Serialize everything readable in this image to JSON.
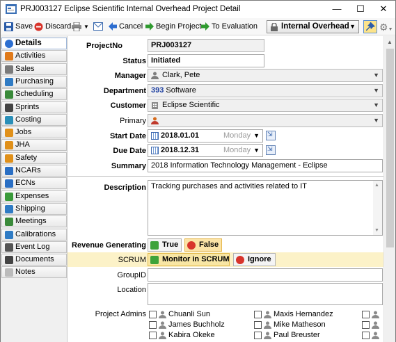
{
  "window": {
    "title": "PRJ003127 Eclipse Scientific Internal Overhead Project Detail",
    "minimize": "—",
    "maximize": "☐",
    "close": "✕"
  },
  "toolbar": {
    "save": "Save",
    "discard": "Discard",
    "cancel": "Cancel",
    "begin_project": "Begin Project",
    "to_evaluation": "To Evaluation",
    "mode": "Internal Overhead"
  },
  "sidebar": {
    "items": [
      {
        "label": "Details",
        "icon": "info-icon",
        "color": "#2d6fd1"
      },
      {
        "label": "Activities",
        "icon": "activities-icon",
        "color": "#e07a1a"
      },
      {
        "label": "Sales",
        "icon": "sales-icon",
        "color": "#7a7a7a"
      },
      {
        "label": "Purchasing",
        "icon": "purchasing-icon",
        "color": "#2f7bc4"
      },
      {
        "label": "Scheduling",
        "icon": "scheduling-icon",
        "color": "#3a8a3a"
      },
      {
        "label": "Sprints",
        "icon": "sprints-icon",
        "color": "#444444"
      },
      {
        "label": "Costing",
        "icon": "costing-icon",
        "color": "#2a8fb8"
      },
      {
        "label": "Jobs",
        "icon": "jobs-icon",
        "color": "#e0901a"
      },
      {
        "label": "JHA",
        "icon": "jha-icon",
        "color": "#e0901a"
      },
      {
        "label": "Safety",
        "icon": "safety-icon",
        "color": "#e0901a"
      },
      {
        "label": "NCARs",
        "icon": "ncars-icon",
        "color": "#2a6fc4"
      },
      {
        "label": "ECNs",
        "icon": "ecns-icon",
        "color": "#2a6fc4"
      },
      {
        "label": "Expenses",
        "icon": "expenses-icon",
        "color": "#3a9a3a"
      },
      {
        "label": "Shipping",
        "icon": "shipping-icon",
        "color": "#2f7bc4"
      },
      {
        "label": "Meetings",
        "icon": "meetings-icon",
        "color": "#3a8a3a"
      },
      {
        "label": "Calibrations",
        "icon": "calibrations-icon",
        "color": "#2f7bc4"
      },
      {
        "label": "Event Log",
        "icon": "event-log-icon",
        "color": "#555555"
      },
      {
        "label": "Documents",
        "icon": "documents-icon",
        "color": "#444444"
      },
      {
        "label": "Notes",
        "icon": "notes-icon",
        "color": "#bbbbbb"
      }
    ]
  },
  "form": {
    "project_no": {
      "label": "ProjectNo",
      "value": "PRJ003127"
    },
    "status": {
      "label": "Status",
      "value": "Initiated"
    },
    "manager": {
      "label": "Manager",
      "value": "Clark, Pete"
    },
    "department": {
      "label": "Department",
      "code": "393",
      "name": "Software"
    },
    "customer": {
      "label": "Customer",
      "value": "Eclipse Scientific"
    },
    "primary": {
      "label": "Primary",
      "value": ""
    },
    "start_date": {
      "label": "Start Date",
      "value": "2018.01.01",
      "weekday": "Monday"
    },
    "due_date": {
      "label": "Due Date",
      "value": "2018.12.31",
      "weekday": "Monday"
    },
    "summary": {
      "label": "Summary",
      "value": "2018 Information Technology Management - Eclipse"
    },
    "description": {
      "label": "Description",
      "value": "Tracking purchases and activities related to IT"
    },
    "revenue_generating": {
      "label": "Revenue Generating",
      "true_label": "True",
      "false_label": "False"
    },
    "scrum": {
      "label": "SCRUM",
      "monitor_label": "Monitor in SCRUM",
      "ignore_label": "Ignore"
    },
    "group_id": {
      "label": "GroupID",
      "value": ""
    },
    "location": {
      "label": "Location",
      "value": ""
    },
    "project_admins": {
      "label": "Project Admins",
      "col1": [
        "Chuanli Sun",
        "James Buchholz",
        "Kabira Okeke"
      ],
      "col2": [
        "Maxis Hernandez",
        "Mike Matheson",
        "Paul Breuster"
      ]
    }
  }
}
